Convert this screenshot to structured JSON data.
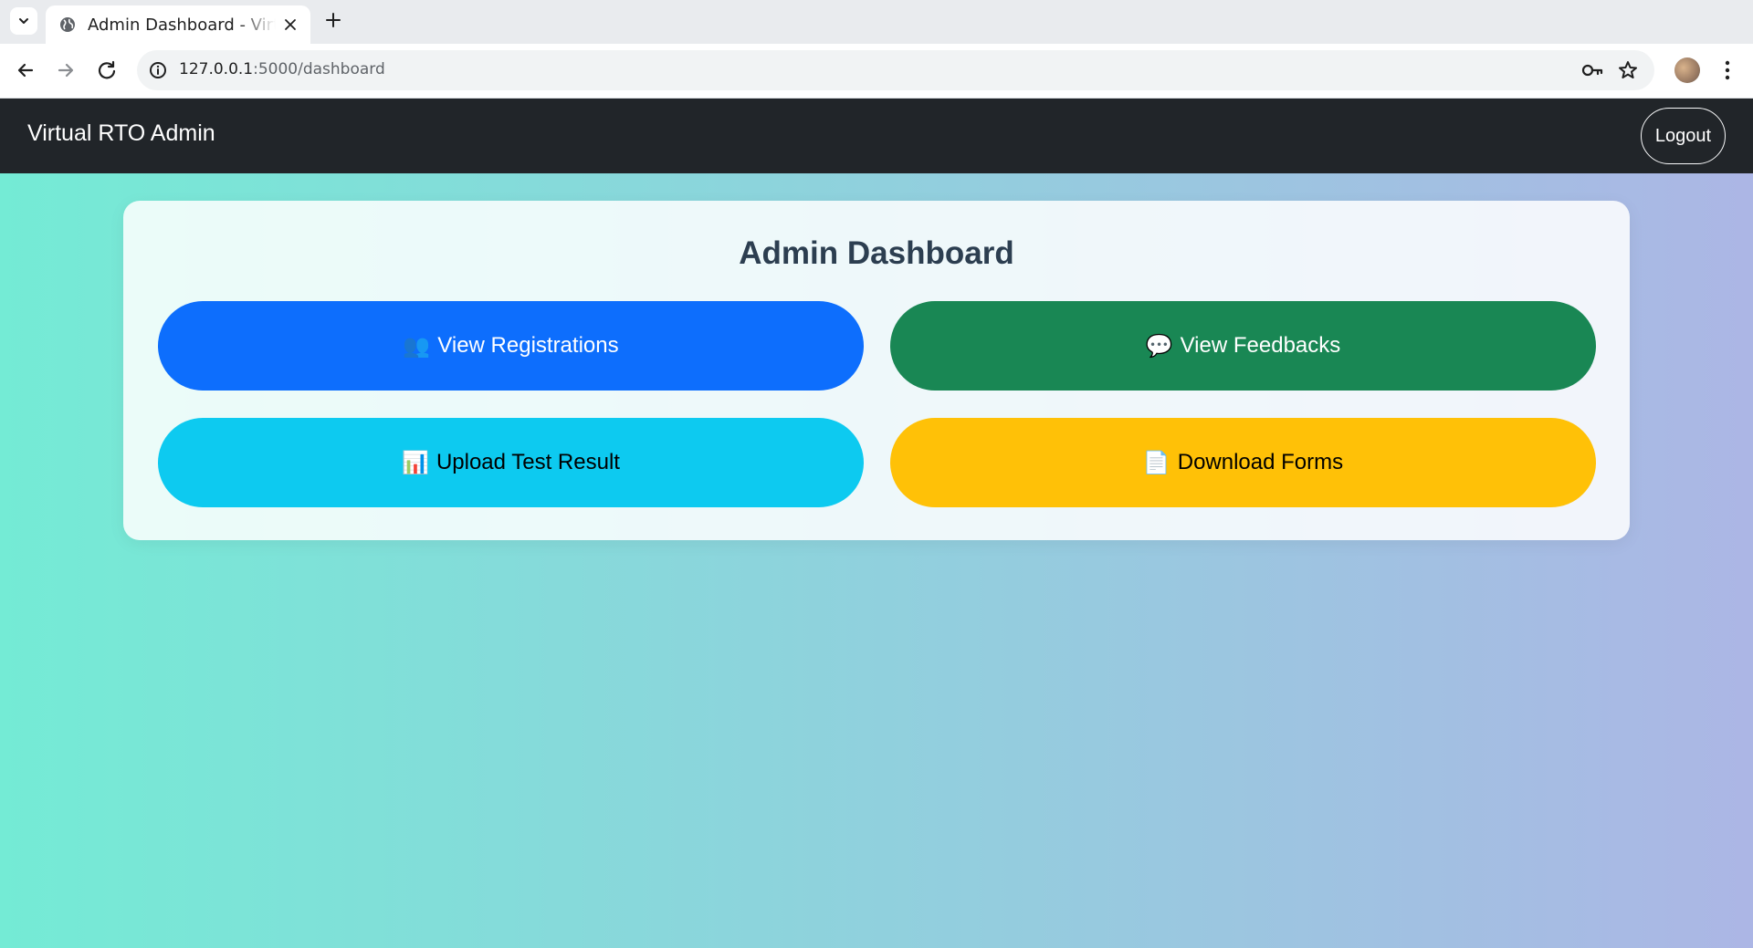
{
  "browser": {
    "tab_title": "Admin Dashboard - Virtual RTO",
    "url_host": "127.0.0.1",
    "url_rest": ":5000/dashboard"
  },
  "navbar": {
    "brand": "Virtual RTO Admin",
    "logout_label": "Logout"
  },
  "dashboard": {
    "title": "Admin Dashboard",
    "buttons": [
      {
        "icon": "users-icon",
        "emoji": "👥",
        "label": "View Registrations",
        "color": "#0d6efd"
      },
      {
        "icon": "speech-bubble-icon",
        "emoji": "💬",
        "label": "View Feedbacks",
        "color": "#198754"
      },
      {
        "icon": "bar-chart-icon",
        "emoji": "📊",
        "label": "Upload Test Result",
        "color": "#0dcaf0"
      },
      {
        "icon": "document-icon",
        "emoji": "📄",
        "label": "Download Forms",
        "color": "#ffc107"
      }
    ]
  },
  "colors": {
    "navbar_bg": "#212529",
    "gradient_start": "#74ebd5",
    "gradient_end": "#acb6e5",
    "title_color": "#2c3e50"
  }
}
